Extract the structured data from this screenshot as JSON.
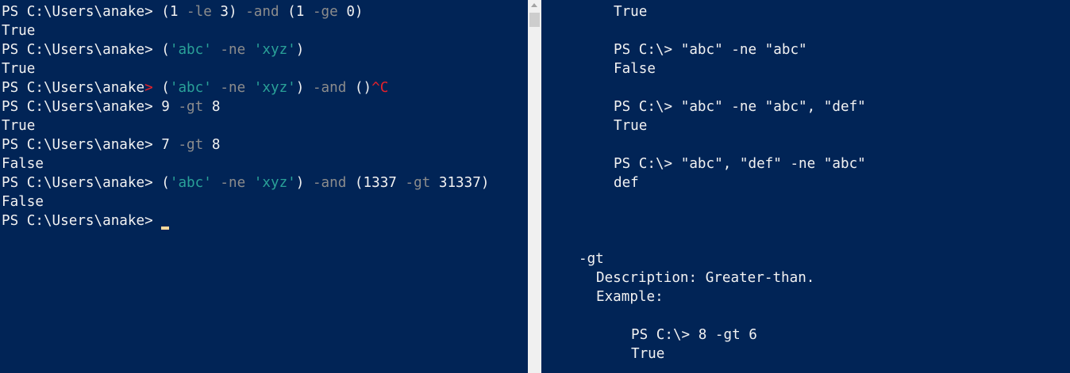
{
  "colors": {
    "background": "#012456",
    "text": "#f2f2f2",
    "operator": "#8c8c8c",
    "string": "#2aa198",
    "error": "#e8212a",
    "cursor": "#ffd89b",
    "scrollbar_track": "#f0f0f0",
    "scrollbar_thumb": "#cdcdcd"
  },
  "left_console": {
    "lines": [
      [
        {
          "t": "PS C:\\Users\\anake> ",
          "c": "text"
        },
        {
          "t": "(1 ",
          "c": "text"
        },
        {
          "t": "-le",
          "c": "operator"
        },
        {
          "t": " 3) ",
          "c": "text"
        },
        {
          "t": "-and",
          "c": "operator"
        },
        {
          "t": " (1 ",
          "c": "text"
        },
        {
          "t": "-ge",
          "c": "operator"
        },
        {
          "t": " 0)",
          "c": "text"
        }
      ],
      [
        {
          "t": "True",
          "c": "text"
        }
      ],
      [
        {
          "t": "PS C:\\Users\\anake> ",
          "c": "text"
        },
        {
          "t": "(",
          "c": "text"
        },
        {
          "t": "'abc'",
          "c": "string"
        },
        {
          "t": " ",
          "c": "text"
        },
        {
          "t": "-ne",
          "c": "operator"
        },
        {
          "t": " ",
          "c": "text"
        },
        {
          "t": "'xyz'",
          "c": "string"
        },
        {
          "t": ")",
          "c": "text"
        }
      ],
      [
        {
          "t": "True",
          "c": "text"
        }
      ],
      [
        {
          "t": "PS C:\\Users\\anake",
          "c": "text"
        },
        {
          "t": ">",
          "c": "error"
        },
        {
          "t": " (",
          "c": "text"
        },
        {
          "t": "'abc'",
          "c": "string"
        },
        {
          "t": " ",
          "c": "text"
        },
        {
          "t": "-ne",
          "c": "operator"
        },
        {
          "t": " ",
          "c": "text"
        },
        {
          "t": "'xyz'",
          "c": "string"
        },
        {
          "t": ") ",
          "c": "text"
        },
        {
          "t": "-and",
          "c": "operator"
        },
        {
          "t": " ()",
          "c": "text"
        },
        {
          "t": "^C",
          "c": "error"
        }
      ],
      [
        {
          "t": "PS C:\\Users\\anake> ",
          "c": "text"
        },
        {
          "t": "9 ",
          "c": "text"
        },
        {
          "t": "-gt",
          "c": "operator"
        },
        {
          "t": " 8",
          "c": "text"
        }
      ],
      [
        {
          "t": "True",
          "c": "text"
        }
      ],
      [
        {
          "t": "PS C:\\Users\\anake> ",
          "c": "text"
        },
        {
          "t": "7 ",
          "c": "text"
        },
        {
          "t": "-gt",
          "c": "operator"
        },
        {
          "t": " 8",
          "c": "text"
        }
      ],
      [
        {
          "t": "False",
          "c": "text"
        }
      ],
      [
        {
          "t": "PS C:\\Users\\anake> ",
          "c": "text"
        },
        {
          "t": "(",
          "c": "text"
        },
        {
          "t": "'abc'",
          "c": "string"
        },
        {
          "t": " ",
          "c": "text"
        },
        {
          "t": "-ne",
          "c": "operator"
        },
        {
          "t": " ",
          "c": "text"
        },
        {
          "t": "'xyz'",
          "c": "string"
        },
        {
          "t": ") ",
          "c": "text"
        },
        {
          "t": "-and",
          "c": "operator"
        },
        {
          "t": " (1337 ",
          "c": "text"
        },
        {
          "t": "-gt",
          "c": "operator"
        },
        {
          "t": " 31337)",
          "c": "text"
        }
      ],
      [
        {
          "t": "False",
          "c": "text"
        }
      ],
      [
        {
          "t": "PS C:\\Users\\anake> ",
          "c": "text"
        }
      ]
    ]
  },
  "right_help": {
    "lines": [
      {
        "text": "True",
        "indent": 91,
        "row": 0
      },
      {
        "text": "PS C:\\> \"abc\" -ne \"abc\"",
        "indent": 91,
        "row": 2
      },
      {
        "text": "False",
        "indent": 91,
        "row": 3
      },
      {
        "text": "PS C:\\> \"abc\" -ne \"abc\", \"def\"",
        "indent": 91,
        "row": 5
      },
      {
        "text": "True",
        "indent": 91,
        "row": 6
      },
      {
        "text": "PS C:\\> \"abc\", \"def\" -ne \"abc\"",
        "indent": 91,
        "row": 8
      },
      {
        "text": "def",
        "indent": 91,
        "row": 9
      },
      {
        "text": "-gt",
        "indent": 47,
        "row": 13
      },
      {
        "text": "Description: Greater-than.",
        "indent": 69,
        "row": 14
      },
      {
        "text": "Example:",
        "indent": 69,
        "row": 15
      },
      {
        "text": "PS C:\\> 8 -gt 6",
        "indent": 113,
        "row": 17
      },
      {
        "text": "True",
        "indent": 113,
        "row": 18
      }
    ]
  }
}
